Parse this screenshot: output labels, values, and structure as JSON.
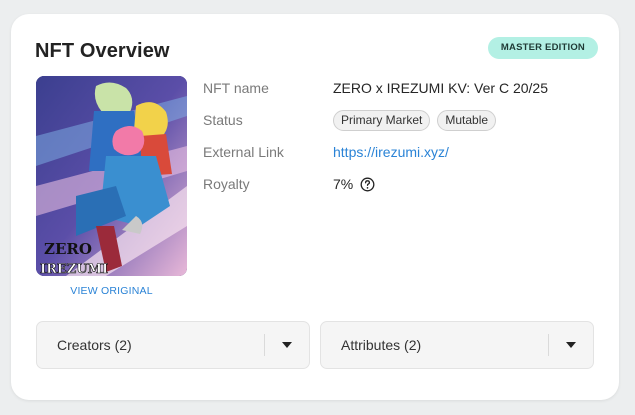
{
  "card": {
    "title": "NFT Overview",
    "badge": "MASTER EDITION"
  },
  "media": {
    "view_original": "VIEW ORIGINAL",
    "art_title_lines": [
      "ZERO",
      "IREZUMI"
    ]
  },
  "details": {
    "rows": [
      {
        "label": "NFT name",
        "value": "ZERO x IREZUMI KV: Ver C 20/25"
      },
      {
        "label": "Status",
        "chips": [
          "Primary Market",
          "Mutable"
        ]
      },
      {
        "label": "External Link",
        "value": "https://irezumi.xyz/"
      },
      {
        "label": "Royalty",
        "value": "7%",
        "icon": "help-circle-icon"
      }
    ]
  },
  "accordions": [
    {
      "label": "Creators (2)",
      "icon": "caret-down-icon"
    },
    {
      "label": "Attributes (2)",
      "icon": "caret-down-icon"
    }
  ],
  "colors": {
    "badge_bg": "#b3f0e4",
    "link": "#2a83d6",
    "card_bg": "#ffffff",
    "page_bg": "#eceeef"
  }
}
